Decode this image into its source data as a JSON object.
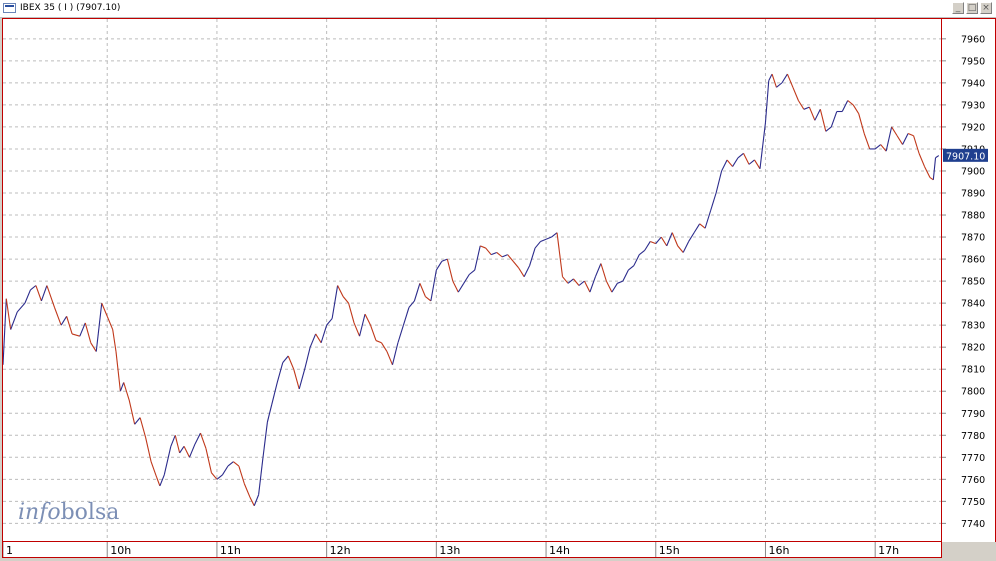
{
  "window": {
    "title": "IBEX 35 ( I ) (7907.10)",
    "min_label": "_",
    "max_label": "□",
    "close_label": "×"
  },
  "logo": {
    "part1": "info",
    "part2": "bolsa"
  },
  "colors": {
    "up": "#2b2b8c",
    "down": "#c0381a",
    "frame": "#c00000",
    "grid": "#bcbcbc",
    "badge": "#1f3f8f"
  },
  "chart_data": {
    "type": "line",
    "title": "IBEX 35 ( I ) (7907.10)",
    "xlabel": "",
    "ylabel": "",
    "ylim": [
      7732,
      7969
    ],
    "y_ticks": [
      7740,
      7750,
      7760,
      7770,
      7780,
      7790,
      7800,
      7810,
      7820,
      7830,
      7840,
      7850,
      7860,
      7870,
      7880,
      7890,
      7900,
      7910,
      7920,
      7930,
      7940,
      7950,
      7960
    ],
    "x_range": [
      9.05,
      17.6
    ],
    "x_tick_positions": [
      9.05,
      10,
      11,
      12,
      13,
      14,
      15,
      16,
      17
    ],
    "x_tick_labels": [
      "1",
      "10h",
      "11h",
      "12h",
      "13h",
      "14h",
      "15h",
      "16h",
      "17h"
    ],
    "grid": true,
    "last_value": 7907.1,
    "last_value_label": "7907.10",
    "series": [
      {
        "values": [
          [
            9.05,
            7812
          ],
          [
            9.08,
            7842
          ],
          [
            9.12,
            7828
          ],
          [
            9.18,
            7836
          ],
          [
            9.25,
            7840
          ],
          [
            9.3,
            7846
          ],
          [
            9.35,
            7848
          ],
          [
            9.4,
            7841
          ],
          [
            9.45,
            7848
          ],
          [
            9.52,
            7838
          ],
          [
            9.58,
            7830
          ],
          [
            9.63,
            7834
          ],
          [
            9.68,
            7826
          ],
          [
            9.75,
            7825
          ],
          [
            9.8,
            7831
          ],
          [
            9.85,
            7822
          ],
          [
            9.9,
            7818
          ],
          [
            9.95,
            7840
          ],
          [
            10.0,
            7834
          ],
          [
            10.05,
            7828
          ],
          [
            10.08,
            7818
          ],
          [
            10.12,
            7800
          ],
          [
            10.15,
            7804
          ],
          [
            10.2,
            7796
          ],
          [
            10.25,
            7785
          ],
          [
            10.3,
            7788
          ],
          [
            10.35,
            7779
          ],
          [
            10.4,
            7768
          ],
          [
            10.45,
            7761
          ],
          [
            10.48,
            7757
          ],
          [
            10.52,
            7762
          ],
          [
            10.58,
            7775
          ],
          [
            10.62,
            7780
          ],
          [
            10.66,
            7772
          ],
          [
            10.7,
            7775
          ],
          [
            10.75,
            7770
          ],
          [
            10.8,
            7776
          ],
          [
            10.85,
            7781
          ],
          [
            10.9,
            7774
          ],
          [
            10.95,
            7763
          ],
          [
            11.0,
            7760
          ],
          [
            11.05,
            7762
          ],
          [
            11.1,
            7766
          ],
          [
            11.15,
            7768
          ],
          [
            11.2,
            7766
          ],
          [
            11.25,
            7758
          ],
          [
            11.3,
            7752
          ],
          [
            11.34,
            7748
          ],
          [
            11.38,
            7753
          ],
          [
            11.42,
            7770
          ],
          [
            11.46,
            7786
          ],
          [
            11.5,
            7794
          ],
          [
            11.55,
            7804
          ],
          [
            11.6,
            7813
          ],
          [
            11.65,
            7816
          ],
          [
            11.7,
            7810
          ],
          [
            11.75,
            7801
          ],
          [
            11.8,
            7810
          ],
          [
            11.85,
            7820
          ],
          [
            11.9,
            7826
          ],
          [
            11.95,
            7822
          ],
          [
            12.0,
            7830
          ],
          [
            12.05,
            7833
          ],
          [
            12.1,
            7848
          ],
          [
            12.15,
            7843
          ],
          [
            12.2,
            7840
          ],
          [
            12.25,
            7831
          ],
          [
            12.3,
            7825
          ],
          [
            12.35,
            7835
          ],
          [
            12.4,
            7830
          ],
          [
            12.45,
            7823
          ],
          [
            12.5,
            7822
          ],
          [
            12.55,
            7818
          ],
          [
            12.6,
            7812
          ],
          [
            12.65,
            7822
          ],
          [
            12.7,
            7830
          ],
          [
            12.75,
            7838
          ],
          [
            12.8,
            7841
          ],
          [
            12.85,
            7849
          ],
          [
            12.9,
            7843
          ],
          [
            12.95,
            7841
          ],
          [
            13.0,
            7855
          ],
          [
            13.05,
            7859
          ],
          [
            13.1,
            7860
          ],
          [
            13.15,
            7850
          ],
          [
            13.2,
            7845
          ],
          [
            13.25,
            7849
          ],
          [
            13.3,
            7853
          ],
          [
            13.35,
            7855
          ],
          [
            13.4,
            7866
          ],
          [
            13.45,
            7865
          ],
          [
            13.5,
            7862
          ],
          [
            13.55,
            7863
          ],
          [
            13.6,
            7861
          ],
          [
            13.65,
            7862
          ],
          [
            13.7,
            7859
          ],
          [
            13.75,
            7856
          ],
          [
            13.8,
            7852
          ],
          [
            13.85,
            7857
          ],
          [
            13.9,
            7865
          ],
          [
            13.95,
            7868
          ],
          [
            14.0,
            7869
          ],
          [
            14.05,
            7870
          ],
          [
            14.1,
            7872
          ],
          [
            14.15,
            7852
          ],
          [
            14.2,
            7849
          ],
          [
            14.25,
            7851
          ],
          [
            14.3,
            7848
          ],
          [
            14.35,
            7850
          ],
          [
            14.4,
            7845
          ],
          [
            14.45,
            7852
          ],
          [
            14.5,
            7858
          ],
          [
            14.55,
            7850
          ],
          [
            14.6,
            7845
          ],
          [
            14.65,
            7849
          ],
          [
            14.7,
            7850
          ],
          [
            14.75,
            7855
          ],
          [
            14.8,
            7857
          ],
          [
            14.85,
            7862
          ],
          [
            14.9,
            7864
          ],
          [
            14.95,
            7868
          ],
          [
            15.0,
            7867
          ],
          [
            15.05,
            7870
          ],
          [
            15.1,
            7866
          ],
          [
            15.15,
            7872
          ],
          [
            15.2,
            7866
          ],
          [
            15.25,
            7863
          ],
          [
            15.3,
            7868
          ],
          [
            15.35,
            7872
          ],
          [
            15.4,
            7876
          ],
          [
            15.45,
            7874
          ],
          [
            15.5,
            7882
          ],
          [
            15.55,
            7890
          ],
          [
            15.6,
            7900
          ],
          [
            15.65,
            7905
          ],
          [
            15.7,
            7902
          ],
          [
            15.75,
            7906
          ],
          [
            15.8,
            7908
          ],
          [
            15.85,
            7903
          ],
          [
            15.9,
            7905
          ],
          [
            15.95,
            7901
          ],
          [
            16.0,
            7922
          ],
          [
            16.03,
            7941
          ],
          [
            16.06,
            7944
          ],
          [
            16.1,
            7938
          ],
          [
            16.15,
            7940
          ],
          [
            16.2,
            7944
          ],
          [
            16.25,
            7938
          ],
          [
            16.3,
            7932
          ],
          [
            16.35,
            7928
          ],
          [
            16.4,
            7929
          ],
          [
            16.45,
            7923
          ],
          [
            16.5,
            7928
          ],
          [
            16.55,
            7918
          ],
          [
            16.6,
            7920
          ],
          [
            16.65,
            7927
          ],
          [
            16.7,
            7927
          ],
          [
            16.75,
            7932
          ],
          [
            16.8,
            7930
          ],
          [
            16.85,
            7926
          ],
          [
            16.9,
            7917
          ],
          [
            16.95,
            7910
          ],
          [
            17.0,
            7910
          ],
          [
            17.05,
            7912
          ],
          [
            17.1,
            7909
          ],
          [
            17.15,
            7920
          ],
          [
            17.2,
            7916
          ],
          [
            17.25,
            7912
          ],
          [
            17.3,
            7917
          ],
          [
            17.35,
            7916
          ],
          [
            17.4,
            7908
          ],
          [
            17.45,
            7902
          ],
          [
            17.5,
            7897
          ],
          [
            17.53,
            7896
          ],
          [
            17.55,
            7906
          ],
          [
            17.58,
            7907
          ]
        ]
      }
    ]
  }
}
